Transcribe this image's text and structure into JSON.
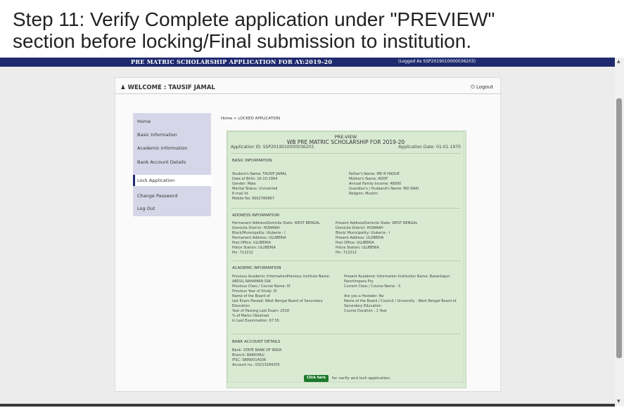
{
  "caption": [
    "Step 11: Verify Complete application under \"PREVIEW\"",
    "section before locking/Final submission to institution."
  ],
  "topbar": {
    "title": "PRE MATRIC SCHOLARSHIP APPLICATION FOR AY:2019-20",
    "logged": "(Logged As SSP2019010000036203)"
  },
  "welcome": "WELCOME : TAUSIF JAMAL",
  "logout": "Logout",
  "menu": [
    "Home",
    "Basic Information",
    "Academic Information",
    "Bank Account Details",
    "Lock Application",
    "Change Password",
    "Log Out"
  ],
  "breadcrumb": "Home > LOCKED APPLICATION",
  "preview": {
    "t1": "PRE-VIEW",
    "t2": "WB PRE MATRIC SCHOLARSHIP FOR 2019-20",
    "app_id": "Application ID: SSP2019010000036203",
    "app_date": "Application Date: 01-01-1970"
  },
  "basic": {
    "heading": "BASIC INFORMATION",
    "left": [
      "Student's Name: TAUSIF JAMAL",
      "Date of Birth: 16-10-1994",
      "Gender: Male",
      "Marital Status: Unmarried",
      "E-mail Id:",
      "Mobile No: 9002780867"
    ],
    "right": [
      "Father's Name: MD R HAQUE",
      "Mother's Name: ADDF",
      "Annual Family Income: 48000",
      "Guardian's / Husband's Name: MD NAKI",
      "Religion: Muslim"
    ]
  },
  "address": {
    "heading": "ADDRESS INFORMATION",
    "left": [
      "Permanent AddressDomicile State: WEST BENGAL",
      "Domicile District: HOWRAH",
      "Block/Municipality: Uluberia - I",
      "Permanent Address: ULUBERIA",
      "Post Office: ULUBERIA",
      "Police Station: ULUBERIA",
      "Pin: 712212"
    ],
    "right": [
      "Present AddressDomicile State: WEST BENGAL",
      "Domicile District: HOWRAH",
      "Block/ Municipality: Uluberia - I",
      "Present Address: ULUBERIA",
      "Post Office: ULUBERIA",
      "Police Station: ULUBERIA",
      "Pin: 712212"
    ]
  },
  "academic": {
    "heading": "ACADEMIC INFORMATION",
    "left": [
      "Previous Academic InformationPrevious Institute Name:",
      "ABDUL RAHAMAN SSK",
      "Previous Class / Course Name: IX",
      "Previous Year of Study: IX",
      "Name of the Board of",
      "last Exam Passed: West Bengal Board of Secondary",
      "Education",
      "Year of Passing Last Exam: 2018",
      "% of Marks Obtained",
      "in Last Examination: 67.55"
    ],
    "right": [
      "Present Academic Information Institution Name: Basantapur",
      "Paschimpara Pry.",
      "Current Class / Course Name : X",
      "",
      "Are you a Hosteler: No",
      "Name of the Board / Council / University : West Bengal Board of",
      "Secondary Education",
      "Course Duration : 1 Year"
    ]
  },
  "bank": {
    "heading": "BANK ACCOUNT DETAILS",
    "lines": [
      "Bank: STATE BANK OF INDIA",
      "Branch: BAKKHALI",
      "IFSC: SBIN0014036",
      "Account no.: 03213284255"
    ]
  },
  "action": {
    "button": "Click here",
    "text": "for verify and lock application."
  }
}
